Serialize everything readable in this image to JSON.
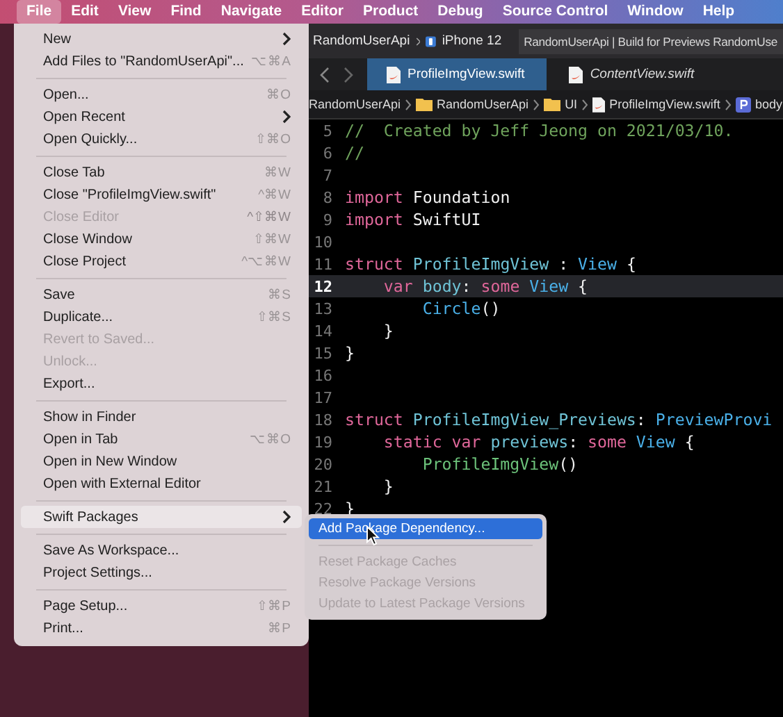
{
  "menu_bar": [
    {
      "label": "File",
      "selected": true
    },
    {
      "label": "Edit",
      "selected": false
    },
    {
      "label": "View",
      "selected": false
    },
    {
      "label": "Find",
      "selected": false
    },
    {
      "label": "Navigate",
      "selected": false
    },
    {
      "label": "Editor",
      "selected": false
    },
    {
      "label": "Product",
      "selected": false
    },
    {
      "label": "Debug",
      "selected": false
    },
    {
      "label": "Source Control",
      "selected": false
    },
    {
      "label": "Window",
      "selected": false
    },
    {
      "label": "Help",
      "selected": false
    }
  ],
  "toolbar": {
    "scheme": "RandomUserApi",
    "device": "iPhone 12",
    "status": "RandomUserApi | Build for Previews RandomUse"
  },
  "tabs": [
    {
      "label": "ProfileImgView.swift",
      "selected": true,
      "preview": false
    },
    {
      "label": "ContentView.swift",
      "selected": false,
      "preview": true
    }
  ],
  "breadcrumb": [
    {
      "label": "RandomUserApi",
      "kind": "project"
    },
    {
      "label": "RandomUserApi",
      "kind": "folder"
    },
    {
      "label": "UI",
      "kind": "folder"
    },
    {
      "label": "ProfileImgView.swift",
      "kind": "file"
    },
    {
      "label": "body",
      "kind": "property"
    }
  ],
  "code_lines": [
    {
      "number": "5",
      "current": false,
      "tokens": [
        {
          "text": "//  Created by Jeff Jeong on 2021/03/10.",
          "kind": "comment"
        }
      ]
    },
    {
      "number": "6",
      "current": false,
      "tokens": [
        {
          "text": "//",
          "kind": "comment"
        }
      ]
    },
    {
      "number": "7",
      "current": false
    },
    {
      "number": "8",
      "current": false,
      "tokens": [
        {
          "text": "import",
          "kind": "keyword"
        },
        {
          "text": " Foundation",
          "kind": "plain"
        }
      ]
    },
    {
      "number": "9",
      "current": false,
      "tokens": [
        {
          "text": "import",
          "kind": "keyword"
        },
        {
          "text": " SwiftUI",
          "kind": "plain"
        }
      ]
    },
    {
      "number": "10",
      "current": false
    },
    {
      "number": "11",
      "current": false,
      "tokens": [
        {
          "text": "struct",
          "kind": "keyword"
        },
        {
          "text": " ProfileImgView",
          "kind": "decl"
        },
        {
          "text": " : ",
          "kind": "plain"
        },
        {
          "text": "View",
          "kind": "type"
        },
        {
          "text": " {",
          "kind": "plain"
        }
      ]
    },
    {
      "number": "12",
      "current": true,
      "tokens": [
        {
          "text": "    var",
          "kind": "keyword"
        },
        {
          "text": " body",
          "kind": "decl"
        },
        {
          "text": ": ",
          "kind": "plain"
        },
        {
          "text": "some",
          "kind": "keyword"
        },
        {
          "text": " View",
          "kind": "type"
        },
        {
          "text": " {",
          "kind": "plain"
        }
      ]
    },
    {
      "number": "13",
      "current": false,
      "tokens": [
        {
          "text": "        Circle",
          "kind": "type"
        },
        {
          "text": "()",
          "kind": "plain"
        }
      ]
    },
    {
      "number": "14",
      "current": false,
      "tokens": [
        {
          "text": "    }",
          "kind": "plain"
        }
      ]
    },
    {
      "number": "15",
      "current": false,
      "tokens": [
        {
          "text": "}",
          "kind": "plain"
        }
      ]
    },
    {
      "number": "16",
      "current": false
    },
    {
      "number": "17",
      "current": false
    },
    {
      "number": "18",
      "current": false,
      "tokens": [
        {
          "text": "struct",
          "kind": "keyword"
        },
        {
          "text": " ProfileImgView_Previews",
          "kind": "decl"
        },
        {
          "text": ": ",
          "kind": "plain"
        },
        {
          "text": "PreviewProvi",
          "kind": "type"
        }
      ]
    },
    {
      "number": "19",
      "current": false,
      "tokens": [
        {
          "text": "    static var",
          "kind": "keyword"
        },
        {
          "text": " previews",
          "kind": "decl"
        },
        {
          "text": ": ",
          "kind": "plain"
        },
        {
          "text": "some",
          "kind": "keyword"
        },
        {
          "text": " View",
          "kind": "type"
        },
        {
          "text": " {",
          "kind": "plain"
        }
      ]
    },
    {
      "number": "20",
      "current": false,
      "tokens": [
        {
          "text": "        ProfileImgView",
          "kind": "call"
        },
        {
          "text": "()",
          "kind": "plain"
        }
      ]
    },
    {
      "number": "21",
      "current": false,
      "tokens": [
        {
          "text": "    }",
          "kind": "plain"
        }
      ]
    },
    {
      "number": "22",
      "current": false,
      "tokens": [
        {
          "text": "}",
          "kind": "plain"
        }
      ]
    }
  ],
  "file_menu": [
    {
      "kind": "item",
      "label": "New",
      "submenu": true,
      "disabled": false,
      "highlighted": false
    },
    {
      "kind": "item",
      "label": "Add Files to \"RandomUserApi\"...",
      "shortcut": "⌥⌘A",
      "submenu": false,
      "disabled": false,
      "highlighted": false
    },
    {
      "kind": "separator"
    },
    {
      "kind": "item",
      "label": "Open...",
      "shortcut": "⌘O",
      "submenu": false,
      "disabled": false,
      "highlighted": false
    },
    {
      "kind": "item",
      "label": "Open Recent",
      "submenu": true,
      "disabled": false,
      "highlighted": false
    },
    {
      "kind": "item",
      "label": "Open Quickly...",
      "shortcut": "⇧⌘O",
      "submenu": false,
      "disabled": false,
      "highlighted": false
    },
    {
      "kind": "separator"
    },
    {
      "kind": "item",
      "label": "Close Tab",
      "shortcut": "⌘W",
      "submenu": false,
      "disabled": false,
      "highlighted": false
    },
    {
      "kind": "item",
      "label": "Close \"ProfileImgView.swift\"",
      "shortcut": "^⌘W",
      "submenu": false,
      "disabled": false,
      "highlighted": false
    },
    {
      "kind": "item",
      "label": "Close Editor",
      "shortcut": "^⇧⌘W",
      "submenu": false,
      "disabled": true,
      "highlighted": false
    },
    {
      "kind": "item",
      "label": "Close Window",
      "shortcut": "⇧⌘W",
      "submenu": false,
      "disabled": false,
      "highlighted": false
    },
    {
      "kind": "item",
      "label": "Close Project",
      "shortcut": "^⌥⌘W",
      "submenu": false,
      "disabled": false,
      "highlighted": false
    },
    {
      "kind": "separator"
    },
    {
      "kind": "item",
      "label": "Save",
      "shortcut": "⌘S",
      "submenu": false,
      "disabled": false,
      "highlighted": false
    },
    {
      "kind": "item",
      "label": "Duplicate...",
      "shortcut": "⇧⌘S",
      "submenu": false,
      "disabled": false,
      "highlighted": false
    },
    {
      "kind": "item",
      "label": "Revert to Saved...",
      "submenu": false,
      "disabled": true,
      "highlighted": false
    },
    {
      "kind": "item",
      "label": "Unlock...",
      "submenu": false,
      "disabled": true,
      "highlighted": false
    },
    {
      "kind": "item",
      "label": "Export...",
      "submenu": false,
      "disabled": false,
      "highlighted": false
    },
    {
      "kind": "separator"
    },
    {
      "kind": "item",
      "label": "Show in Finder",
      "submenu": false,
      "disabled": false,
      "highlighted": false
    },
    {
      "kind": "item",
      "label": "Open in Tab",
      "shortcut": "⌥⌘O",
      "submenu": false,
      "disabled": false,
      "highlighted": false
    },
    {
      "kind": "item",
      "label": "Open in New Window",
      "submenu": false,
      "disabled": false,
      "highlighted": false
    },
    {
      "kind": "item",
      "label": "Open with External Editor",
      "submenu": false,
      "disabled": false,
      "highlighted": false
    },
    {
      "kind": "separator"
    },
    {
      "kind": "item",
      "label": "Swift Packages",
      "submenu": true,
      "disabled": false,
      "highlighted": true
    },
    {
      "kind": "separator"
    },
    {
      "kind": "item",
      "label": "Save As Workspace...",
      "submenu": false,
      "disabled": false,
      "highlighted": false
    },
    {
      "kind": "item",
      "label": "Project Settings...",
      "submenu": false,
      "disabled": false,
      "highlighted": false
    },
    {
      "kind": "separator"
    },
    {
      "kind": "item",
      "label": "Page Setup...",
      "shortcut": "⇧⌘P",
      "submenu": false,
      "disabled": false,
      "highlighted": false
    },
    {
      "kind": "item",
      "label": "Print...",
      "shortcut": "⌘P",
      "submenu": false,
      "disabled": false,
      "highlighted": false
    }
  ],
  "swift_packages_menu": [
    {
      "kind": "item",
      "label": "Add Package Dependency...",
      "disabled": false,
      "selected": true
    },
    {
      "kind": "separator"
    },
    {
      "kind": "item",
      "label": "Reset Package Caches",
      "disabled": true,
      "selected": false
    },
    {
      "kind": "item",
      "label": "Resolve Package Versions",
      "disabled": true,
      "selected": false
    },
    {
      "kind": "item",
      "label": "Update to Latest Package Versions",
      "disabled": true,
      "selected": false
    }
  ]
}
